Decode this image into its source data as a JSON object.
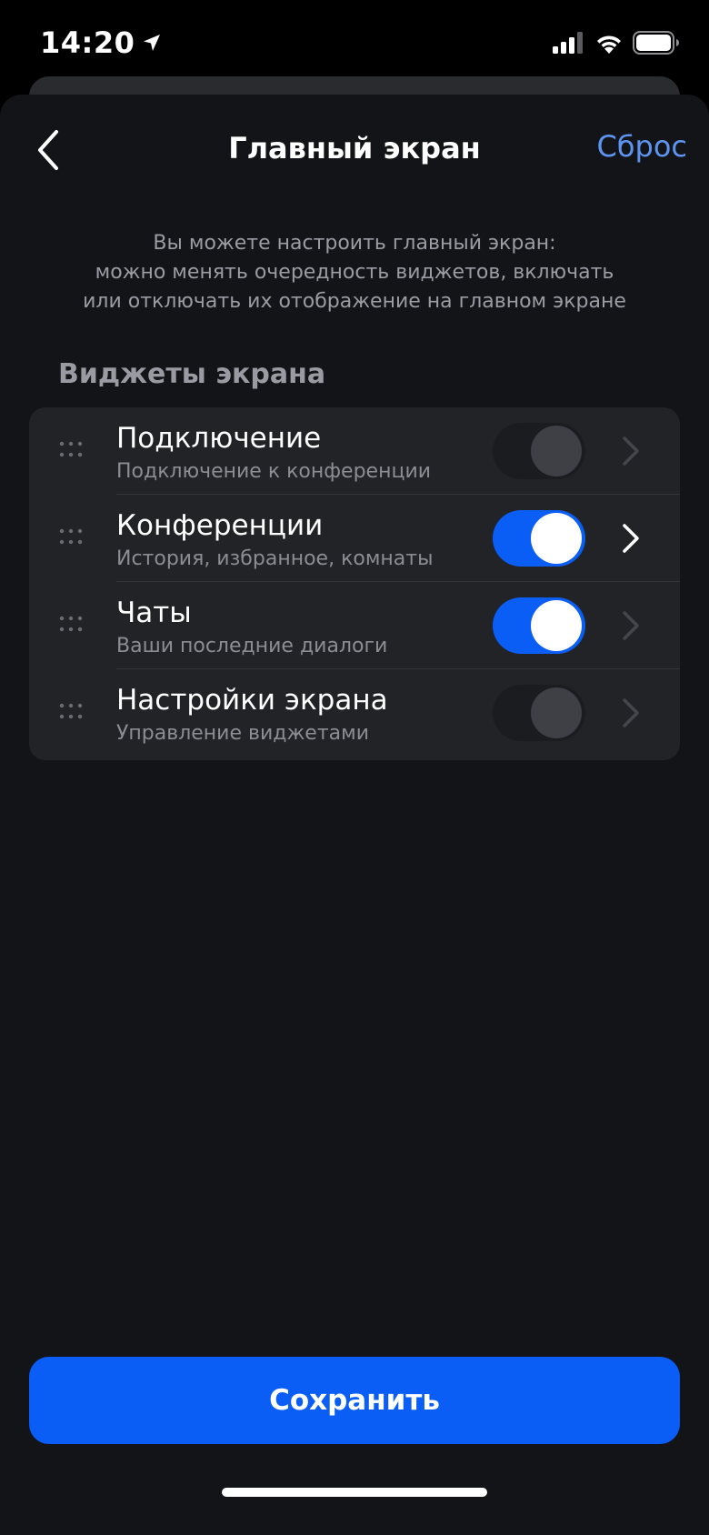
{
  "status_bar": {
    "time": "14:20",
    "location_icon": "location-arrow-icon",
    "signal_icon": "cellular-signal-icon",
    "wifi_icon": "wifi-icon",
    "battery_icon": "battery-icon"
  },
  "nav": {
    "back_icon": "chevron-left-icon",
    "title": "Главный экран",
    "reset_label": "Сброс"
  },
  "description": {
    "lines": [
      "Вы можете настроить главный экран:",
      "можно менять очередность виджетов, включать",
      "или отключать их отображение на главном экране"
    ]
  },
  "section": {
    "title": "Виджеты экрана"
  },
  "widgets": [
    {
      "title": "Подключение",
      "subtitle": "Подключение к конференции",
      "enabled": false
    },
    {
      "title": "Конференции",
      "subtitle": "История, избранное, комнаты",
      "enabled": true
    },
    {
      "title": "Чаты",
      "subtitle": "Ваши последние диалоги",
      "enabled": true
    },
    {
      "title": "Настройки экрана",
      "subtitle": "Управление виджетами",
      "enabled": false
    }
  ],
  "save_button": {
    "label": "Сохранить"
  },
  "colors": {
    "accent": "#0b5ef5",
    "link": "#5d94f2",
    "sheet_background": "#131417",
    "card_background": "#222327"
  }
}
